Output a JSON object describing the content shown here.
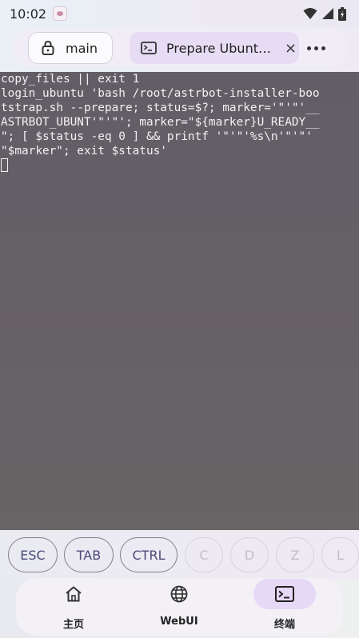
{
  "status_bar": {
    "time": "10:02",
    "icons": [
      "app-notification-icon",
      "wifi-icon",
      "signal-icon",
      "battery-icon"
    ]
  },
  "tabs": [
    {
      "label": "main",
      "icon": "lock-icon",
      "active": false
    },
    {
      "label": "Prepare Ubuntu",
      "display": "Prepare Ubunt…",
      "icon": "terminal-icon",
      "active": true,
      "close_icon": "×"
    }
  ],
  "tab_more_icon": "more-horiz-icon",
  "terminal": {
    "lines": [
      "copy_files || exit 1",
      "login_ubuntu 'bash /root/astrbot-installer-boo",
      "tstrap.sh --prepare; status=$?; marker='\"'\"'__",
      "ASTRBOT_UBUNT'\"'\"'; marker=\"${marker}U_READY__",
      "\"; [ $status -eq 0 ] && printf '\"'\"'%s\\n'\"'\"'",
      "\"$marker\"; exit $status'"
    ],
    "background": "#645f66",
    "text_color": "#f2f2f2"
  },
  "keys": [
    {
      "label": "ESC",
      "enabled": true
    },
    {
      "label": "TAB",
      "enabled": true
    },
    {
      "label": "CTRL",
      "enabled": true
    },
    {
      "label": "C",
      "enabled": false
    },
    {
      "label": "D",
      "enabled": false
    },
    {
      "label": "Z",
      "enabled": false
    },
    {
      "label": "L",
      "enabled": false
    }
  ],
  "bottom_nav": [
    {
      "label": "主页",
      "icon": "home-icon",
      "active": false
    },
    {
      "label": "WebUI",
      "icon": "globe-icon",
      "active": false
    },
    {
      "label": "终端",
      "icon": "terminal-icon",
      "active": true
    }
  ],
  "colors": {
    "accent": "#e5d9f6",
    "key_text": "#4d4a7a",
    "key_disabled": "#c2bec6"
  }
}
